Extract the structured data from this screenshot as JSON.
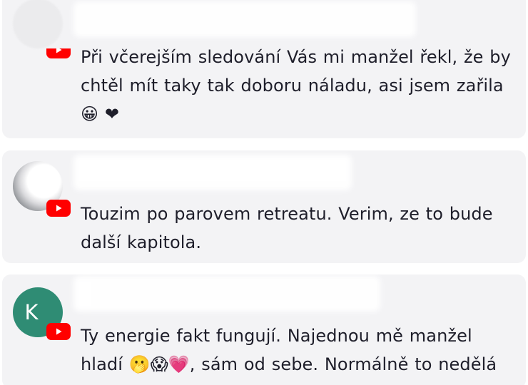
{
  "comments": [
    {
      "avatar_initial": "",
      "source_icon": "youtube-icon",
      "text": "Při včerejším sledování Vás mi manžel řekl, že by chtěl mít taky tak doboru náladu, asi jsem zařila 😀 ❤"
    },
    {
      "avatar_initial": "",
      "source_icon": "youtube-icon",
      "text": "Touzim po parovem retreatu. Verim, ze to bude další kapitola."
    },
    {
      "avatar_initial": "K",
      "source_icon": "youtube-icon",
      "text": "Ty energie fakt fungují. Najednou mě manžel hladí 🫢😱💗, sám od sebe. Normálně to nedělá"
    }
  ],
  "colors": {
    "card_background": "#f3f3f5",
    "text": "#1e1e2a",
    "youtube_red": "#ff0000",
    "avatar_k": "#2f8c74"
  }
}
